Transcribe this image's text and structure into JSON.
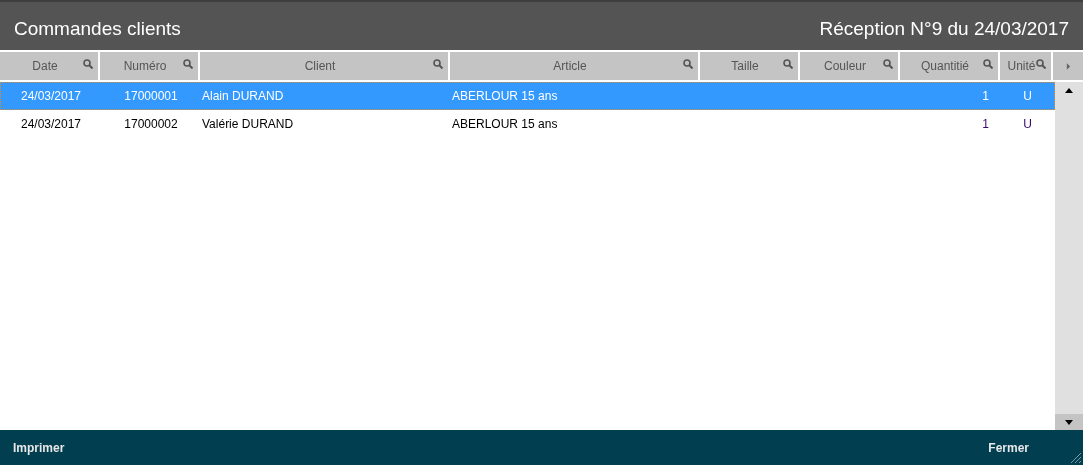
{
  "window": {
    "title": "Commandes clients",
    "subtitle": "Réception N°9 du 24/03/2017"
  },
  "table": {
    "columns": [
      "Date",
      "Numéro",
      "Client",
      "Article",
      "Taille",
      "Couleur",
      "Quantitié",
      "Unité"
    ],
    "rows": [
      {
        "selected": true,
        "cells": [
          "24/03/2017",
          "17000001",
          "Alain DURAND",
          "ABERLOUR 15 ans",
          "",
          "",
          "1",
          "U"
        ]
      },
      {
        "selected": false,
        "cells": [
          "24/03/2017",
          "17000002",
          "Valérie DURAND",
          "ABERLOUR 15 ans",
          "",
          "",
          "1",
          "U"
        ]
      }
    ]
  },
  "footer": {
    "left_button": "Imprimer",
    "right_button": "Fermer"
  }
}
